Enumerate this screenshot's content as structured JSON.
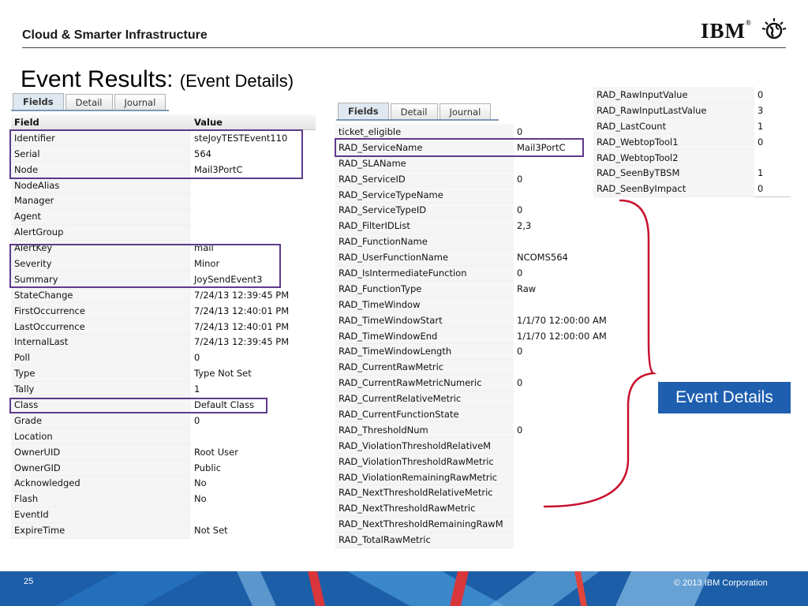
{
  "header": {
    "title": "Cloud & Smarter Infrastructure",
    "logo_text": "IBM",
    "logo_registered": "®"
  },
  "slide": {
    "title": "Event Results:",
    "subtitle": "(Event Details)"
  },
  "left_panel": {
    "tabs": [
      "Fields",
      "Detail",
      "Journal"
    ],
    "active_tab": "Fields",
    "columns": [
      "Field",
      "Value"
    ],
    "rows": [
      [
        "Identifier",
        "steJoyTESTEvent110"
      ],
      [
        "Serial",
        "564"
      ],
      [
        "Node",
        "Mail3PortC"
      ],
      [
        "NodeAlias",
        ""
      ],
      [
        "Manager",
        ""
      ],
      [
        "Agent",
        ""
      ],
      [
        "AlertGroup",
        ""
      ],
      [
        "AlertKey",
        "mail"
      ],
      [
        "Severity",
        "Minor"
      ],
      [
        "Summary",
        "JoySendEvent3"
      ],
      [
        "StateChange",
        "7/24/13 12:39:45 PM"
      ],
      [
        "FirstOccurrence",
        "7/24/13 12:40:01 PM"
      ],
      [
        "LastOccurrence",
        "7/24/13 12:40:01 PM"
      ],
      [
        "InternalLast",
        "7/24/13 12:39:45 PM"
      ],
      [
        "Poll",
        "0"
      ],
      [
        "Type",
        "Type Not Set"
      ],
      [
        "Tally",
        "1"
      ],
      [
        "Class",
        "Default Class"
      ],
      [
        "Grade",
        "0"
      ],
      [
        "Location",
        ""
      ],
      [
        "OwnerUID",
        "Root User"
      ],
      [
        "OwnerGID",
        "Public"
      ],
      [
        "Acknowledged",
        "No"
      ],
      [
        "Flash",
        "No"
      ],
      [
        "EventId",
        ""
      ],
      [
        "ExpireTime",
        "Not Set"
      ]
    ]
  },
  "middle_panel": {
    "tabs": [
      "Fields",
      "Detail",
      "Journal"
    ],
    "active_tab": "Fields",
    "rows": [
      [
        "ticket_eligible",
        "0"
      ],
      [
        "RAD_ServiceName",
        "Mail3PortC"
      ],
      [
        "RAD_SLAName",
        ""
      ],
      [
        "RAD_ServiceID",
        "0"
      ],
      [
        "RAD_ServiceTypeName",
        ""
      ],
      [
        "RAD_ServiceTypeID",
        "0"
      ],
      [
        "RAD_FilterIDList",
        "2,3"
      ],
      [
        "RAD_FunctionName",
        ""
      ],
      [
        "RAD_UserFunctionName",
        "NCOMS564"
      ],
      [
        "RAD_IsIntermediateFunction",
        "0"
      ],
      [
        "RAD_FunctionType",
        "Raw"
      ],
      [
        "RAD_TimeWindow",
        ""
      ],
      [
        "RAD_TimeWindowStart",
        "1/1/70 12:00:00 AM"
      ],
      [
        "RAD_TimeWindowEnd",
        "1/1/70 12:00:00 AM"
      ],
      [
        "RAD_TimeWindowLength",
        "0"
      ],
      [
        "RAD_CurrentRawMetric",
        ""
      ],
      [
        "RAD_CurrentRawMetricNumeric",
        "0"
      ],
      [
        "RAD_CurrentRelativeMetric",
        ""
      ],
      [
        "RAD_CurrentFunctionState",
        ""
      ],
      [
        "RAD_ThresholdNum",
        "0"
      ],
      [
        "RAD_ViolationThresholdRelativeM",
        ""
      ],
      [
        "RAD_ViolationThresholdRawMetric",
        ""
      ],
      [
        "RAD_ViolationRemainingRawMetric",
        ""
      ],
      [
        "RAD_NextThresholdRelativeMetric",
        ""
      ],
      [
        "RAD_NextThresholdRawMetric",
        ""
      ],
      [
        "RAD_NextThresholdRemainingRawM",
        ""
      ],
      [
        "RAD_TotalRawMetric",
        ""
      ]
    ]
  },
  "right_panel": {
    "rows": [
      [
        "RAD_RawInputValue",
        "0"
      ],
      [
        "RAD_RawInputLastValue",
        "3"
      ],
      [
        "RAD_LastCount",
        "1"
      ],
      [
        "RAD_WebtopTool1",
        "0"
      ],
      [
        "RAD_WebtopTool2",
        ""
      ],
      [
        "RAD_SeenByTBSM",
        "1"
      ],
      [
        "RAD_SeenByImpact",
        "0"
      ]
    ]
  },
  "callout": {
    "label": "Event Details"
  },
  "footer": {
    "page_number": "25",
    "copyright": "© 2013 IBM Corporation"
  },
  "colors": {
    "highlight_box": "#5f3a8a",
    "brace": "#c8102e",
    "callout_bg": "#1f5fb0",
    "footer_bg": "#1c5ea8"
  }
}
